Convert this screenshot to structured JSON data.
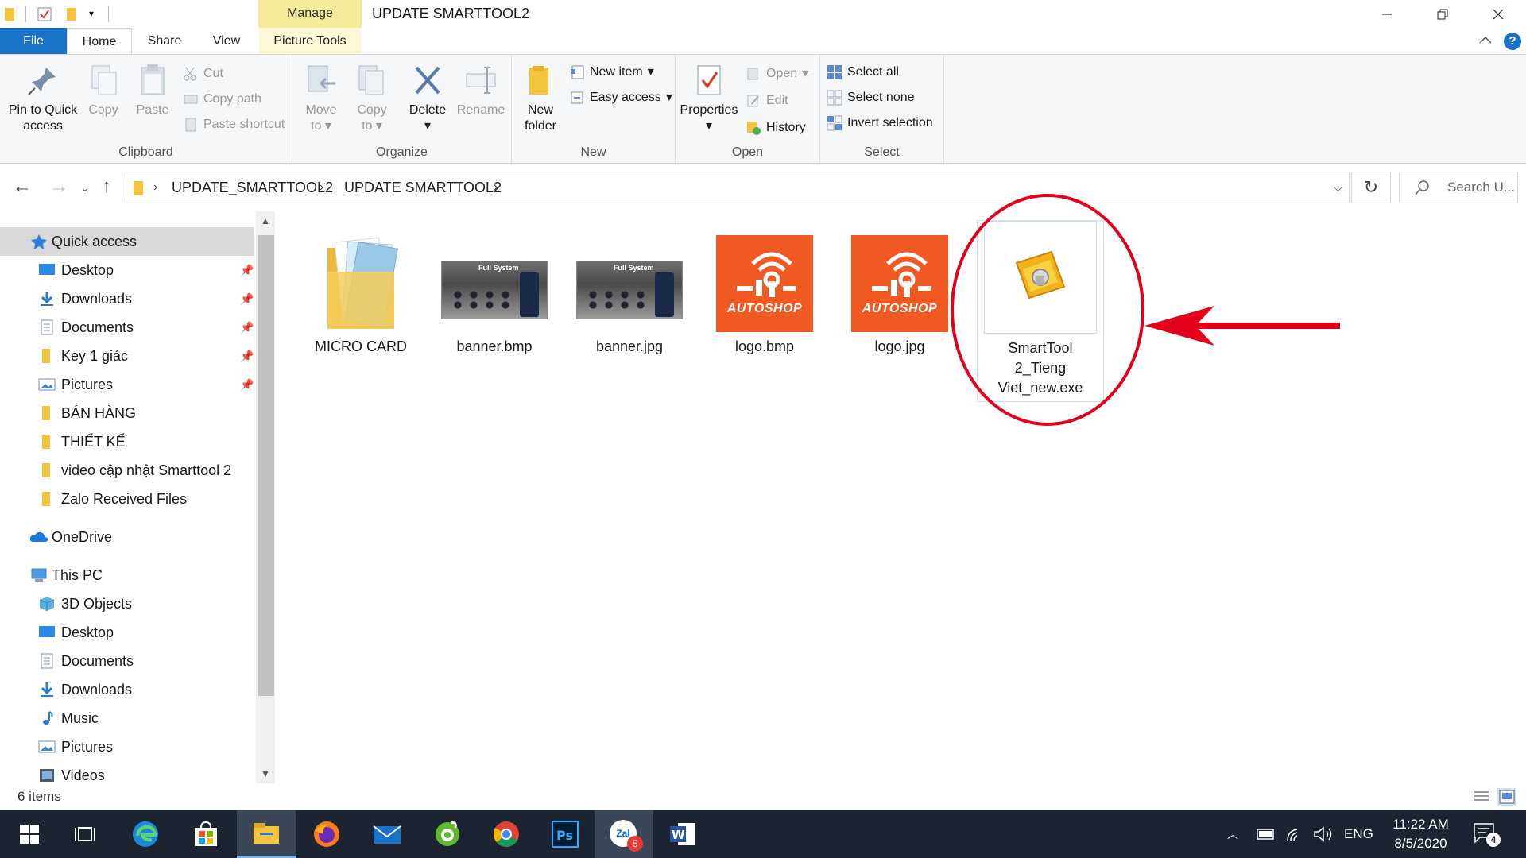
{
  "titlebar": {
    "manage_label": "Manage",
    "window_title": "UPDATE SMARTTOOL2"
  },
  "tabs": {
    "file": "File",
    "home": "Home",
    "share": "Share",
    "view": "View",
    "picture_tools": "Picture Tools"
  },
  "ribbon": {
    "clipboard": {
      "label": "Clipboard",
      "pin": "Pin to Quick access",
      "pin_l1": "Pin to Quick",
      "pin_l2": "access",
      "copy": "Copy",
      "paste": "Paste",
      "cut": "Cut",
      "copy_path": "Copy path",
      "paste_shortcut": "Paste shortcut"
    },
    "organize": {
      "label": "Organize",
      "move_l1": "Move",
      "move_l2": "to",
      "copy_l1": "Copy",
      "copy_l2": "to",
      "delete": "Delete",
      "rename": "Rename"
    },
    "new": {
      "label": "New",
      "folder_l1": "New",
      "folder_l2": "folder",
      "new_item": "New item",
      "easy_access": "Easy access"
    },
    "open": {
      "label": "Open",
      "properties": "Properties",
      "open": "Open",
      "edit": "Edit",
      "history": "History"
    },
    "select": {
      "label": "Select",
      "select_all": "Select all",
      "select_none": "Select none",
      "invert": "Invert selection"
    }
  },
  "address": {
    "crumbs": [
      "UPDATE_SMARTTOOL2",
      "UPDATE SMARTTOOL2"
    ],
    "search_placeholder": "Search U..."
  },
  "navpane": {
    "quick_access": "Quick access",
    "quick_items": [
      {
        "label": "Desktop",
        "pinned": true
      },
      {
        "label": "Downloads",
        "pinned": true
      },
      {
        "label": "Documents",
        "pinned": true
      },
      {
        "label": "Key 1 giác",
        "pinned": true
      },
      {
        "label": "Pictures",
        "pinned": true
      },
      {
        "label": "BÁN HÀNG",
        "pinned": false
      },
      {
        "label": "THIẾT KẾ",
        "pinned": false
      },
      {
        "label": "video cập nhật Smarttool 2",
        "pinned": false
      },
      {
        "label": "Zalo Received Files",
        "pinned": false
      }
    ],
    "onedrive": "OneDrive",
    "this_pc": "This PC",
    "pc_items": [
      "3D Objects",
      "Desktop",
      "Documents",
      "Downloads",
      "Music",
      "Pictures",
      "Videos"
    ]
  },
  "files": [
    {
      "name": "MICRO CARD",
      "type": "folder"
    },
    {
      "name": "banner.bmp",
      "type": "banner"
    },
    {
      "name": "banner.jpg",
      "type": "banner"
    },
    {
      "name": "logo.bmp",
      "type": "logo"
    },
    {
      "name": "logo.jpg",
      "type": "logo"
    },
    {
      "name_l1": "SmartTool",
      "name_l2": "2_Tieng",
      "name_l3": "Viet_new.exe",
      "type": "exe"
    }
  ],
  "banner_thumb_text": "Full System",
  "logo_brand_text": "AUTOSHOP",
  "status": {
    "item_count": "6 items"
  },
  "taskbar": {
    "zalo_badge": "5",
    "zalo_text": "Zal",
    "tray_language": "ENG",
    "time": "11:22 AM",
    "date": "8/5/2020",
    "notification_count": "4"
  },
  "colors": {
    "accent": "#1a73c9",
    "manage_tab": "#f6eb9b",
    "annotation": "#e3001b",
    "logo_orange": "#f05a22",
    "taskbar": "#1c2431"
  }
}
